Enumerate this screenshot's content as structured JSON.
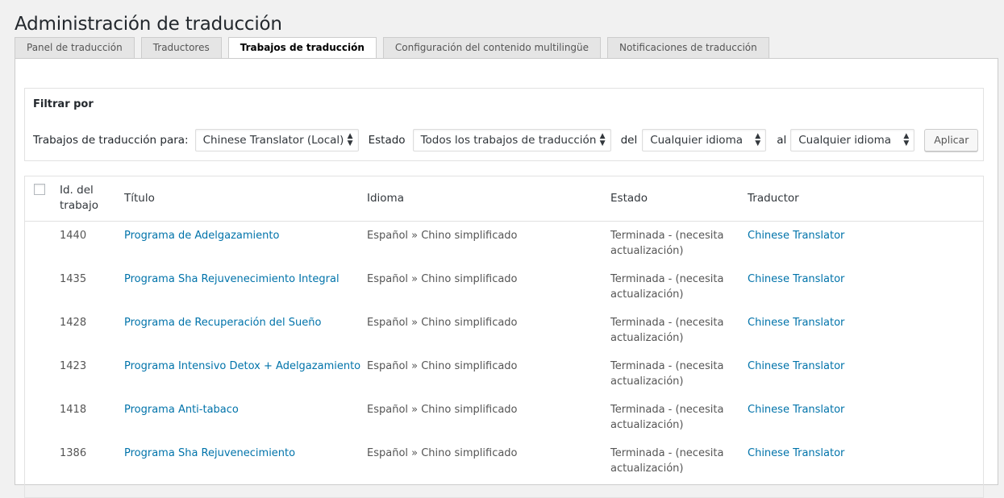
{
  "page": {
    "title": "Administración de traducción"
  },
  "tabs": [
    {
      "label": "Panel de traducción",
      "active": false
    },
    {
      "label": "Traductores",
      "active": false
    },
    {
      "label": "Trabajos de traducción",
      "active": true
    },
    {
      "label": "Configuración del contenido multilingüe",
      "active": false
    },
    {
      "label": "Notificaciones de traducción",
      "active": false
    }
  ],
  "filter": {
    "title": "Filtrar por",
    "jobs_for_label": "Trabajos de traducción para:",
    "jobs_for_value": "Chinese Translator (Local)",
    "status_label": "Estado",
    "status_value": "Todos los trabajos de traducción",
    "from_label": "del",
    "from_value": "Cualquier idioma",
    "to_label": "al",
    "to_value": "Cualquier idioma",
    "apply_label": "Aplicar"
  },
  "table": {
    "headers": {
      "job_id_line1": "Id. del",
      "job_id_line2": "trabajo",
      "title": "Título",
      "language": "Idioma",
      "status": "Estado",
      "translator": "Traductor"
    },
    "rows": [
      {
        "id": "1440",
        "title": "Programa de Adelgazamiento",
        "language": "Español » Chino simplificado",
        "status_line1": "Terminada - (necesita",
        "status_line2": "actualización)",
        "translator": "Chinese Translator"
      },
      {
        "id": "1435",
        "title": "Programa Sha Rejuvenecimiento Integral",
        "language": "Español » Chino simplificado",
        "status_line1": "Terminada - (necesita",
        "status_line2": "actualización)",
        "translator": "Chinese Translator"
      },
      {
        "id": "1428",
        "title": "Programa de Recuperación del Sueño",
        "language": "Español » Chino simplificado",
        "status_line1": "Terminada - (necesita",
        "status_line2": "actualización)",
        "translator": "Chinese Translator"
      },
      {
        "id": "1423",
        "title": "Programa Intensivo Detox + Adelgazamiento",
        "language": "Español » Chino simplificado",
        "status_line1": "Terminada - (necesita",
        "status_line2": "actualización)",
        "translator": "Chinese Translator"
      },
      {
        "id": "1418",
        "title": "Programa Anti-tabaco",
        "language": "Español » Chino simplificado",
        "status_line1": "Terminada - (necesita",
        "status_line2": "actualización)",
        "translator": "Chinese Translator"
      },
      {
        "id": "1386",
        "title": "Programa Sha Rejuvenecimiento",
        "language": "Español » Chino simplificado",
        "status_line1": "Terminada - (necesita",
        "status_line2": "actualización)",
        "translator": "Chinese Translator"
      }
    ]
  },
  "colors": {
    "link": "#0073aa",
    "background": "#f1f1f1",
    "panel": "#ffffff"
  },
  "icons": {
    "select_arrow": "updown-arrows-icon",
    "checkbox": "checkbox-icon"
  }
}
